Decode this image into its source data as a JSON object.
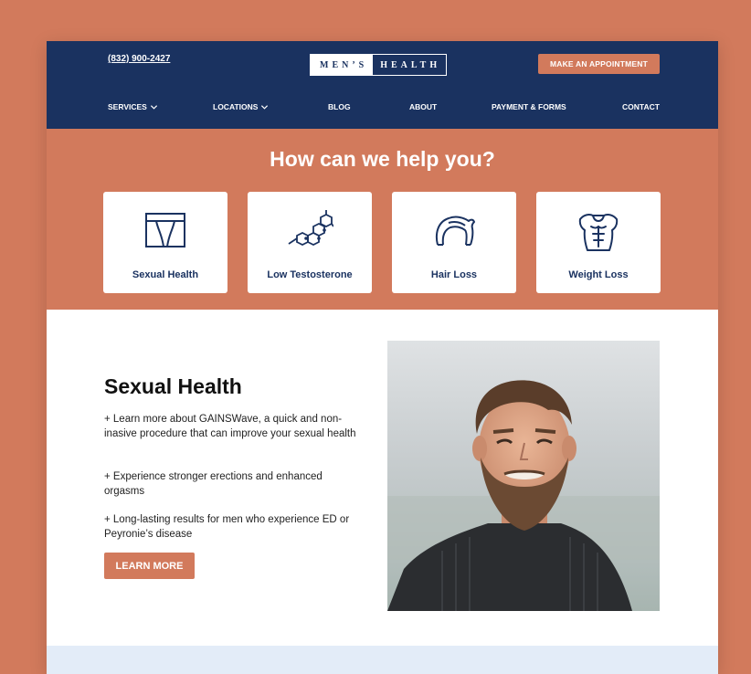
{
  "header": {
    "phone": "(832) 900-2427",
    "logo_left": "MEN’S",
    "logo_right": "HEALTH",
    "appointment_label": "MAKE AN APPOINTMENT"
  },
  "nav": {
    "items": [
      {
        "label": "SERVICES",
        "has_dropdown": true
      },
      {
        "label": "LOCATIONS",
        "has_dropdown": true
      },
      {
        "label": "BLOG",
        "has_dropdown": false
      },
      {
        "label": "ABOUT",
        "has_dropdown": false
      },
      {
        "label": "PAYMENT & FORMS",
        "has_dropdown": false
      },
      {
        "label": "CONTACT",
        "has_dropdown": false
      }
    ]
  },
  "help": {
    "title": "How can we help you?",
    "cards": [
      {
        "label": "Sexual Health",
        "icon": "underwear-icon"
      },
      {
        "label": "Low Testosterone",
        "icon": "molecule-icon"
      },
      {
        "label": "Hair Loss",
        "icon": "hair-icon"
      },
      {
        "label": "Weight Loss",
        "icon": "torso-icon"
      }
    ]
  },
  "feature": {
    "title": "Sexual Health",
    "points": [
      "+ Learn more about GAINSWave, a quick and non-inasive procedure that can improve your sexual health",
      "+ Experience stronger erections and enhanced orgasms",
      "+ Long-lasting results for men who experience ED or Peyronie’s disease"
    ],
    "button_label": "LEARN MORE"
  },
  "colors": {
    "navy": "#1a3260",
    "accent": "#d27a5c",
    "light_band": "#e3ecf8"
  }
}
